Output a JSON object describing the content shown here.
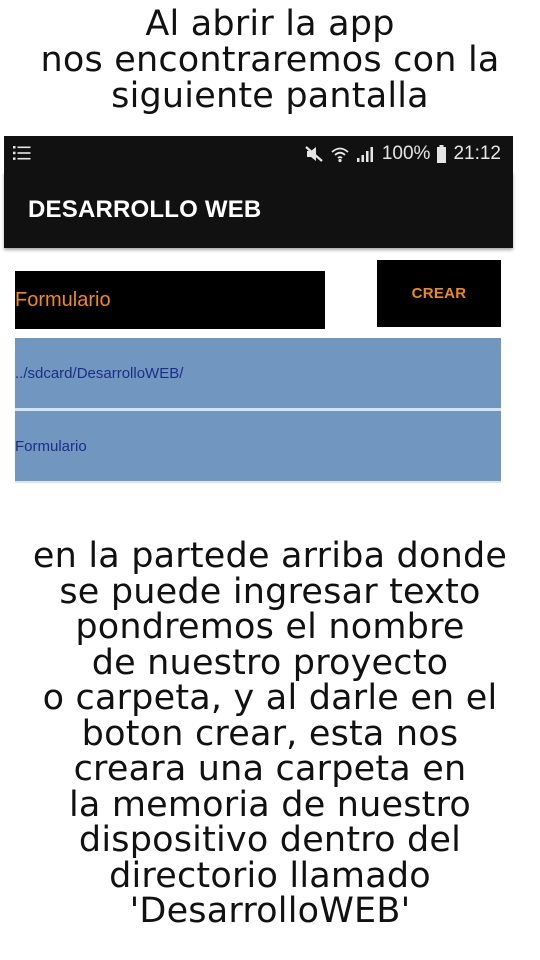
{
  "captions": {
    "top": "Al abrir la app\nnos encontraremos con la\nsiguiente pantalla",
    "bottom": "en la partede arriba donde\nse puede ingresar texto\npondremos el nombre\nde nuestro proyecto\no carpeta, y al darle en el\nboton crear, esta nos\ncreara una carpeta en\nla memoria de nuestro\ndispositivo dentro del\ndirectorio llamado\n'DesarrolloWEB'"
  },
  "statusbar": {
    "battery": "100%",
    "time": "21:12",
    "icons": [
      "menu-icon",
      "mute-icon",
      "wifi-icon",
      "signal-icon",
      "battery-icon"
    ]
  },
  "appbar": {
    "title": "DESARROLLO WEB"
  },
  "form": {
    "name_value": "Formulario",
    "create_label": "CREAR"
  },
  "list": {
    "items": [
      {
        "label": "../sdcard/DesarrolloWEB/"
      },
      {
        "label": "Formulario"
      }
    ]
  },
  "colors": {
    "bar_background": "#111111",
    "accent_text": "#f08a1c",
    "list_background": "#7196bf",
    "list_text": "#1b2f86"
  }
}
